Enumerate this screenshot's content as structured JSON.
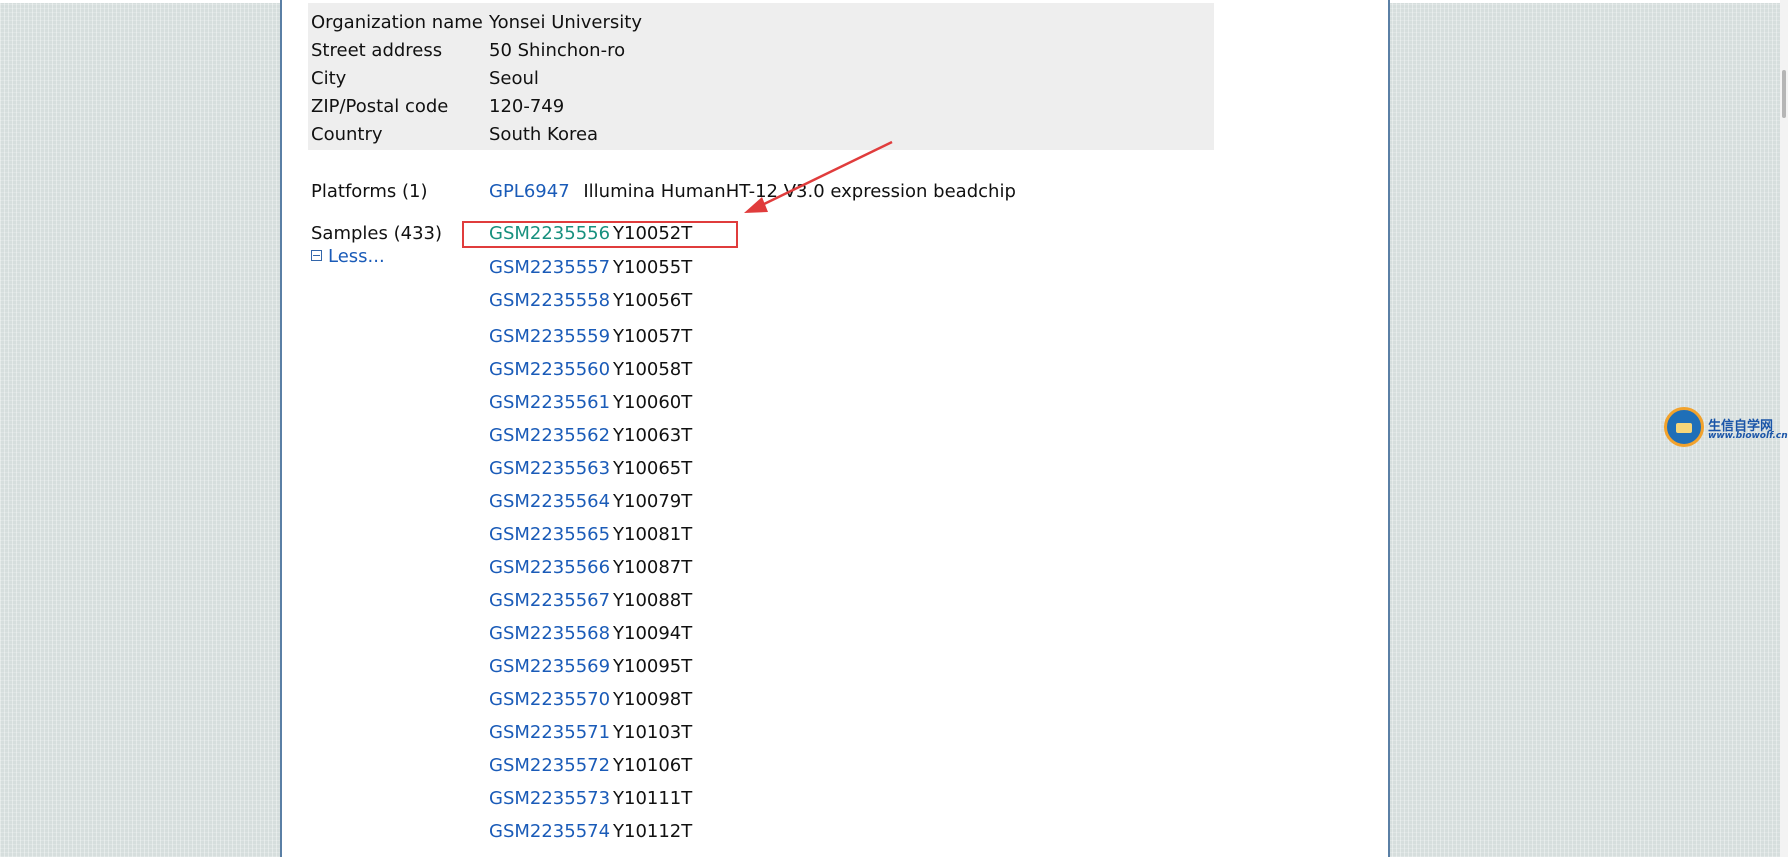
{
  "contact": {
    "rows": [
      {
        "label": "Organization name",
        "value": "Yonsei University"
      },
      {
        "label": "Street address",
        "value": "50 Shinchon-ro"
      },
      {
        "label": "City",
        "value": "Seoul"
      },
      {
        "label": "ZIP/Postal code",
        "value": "120-749"
      },
      {
        "label": "Country",
        "value": "South Korea"
      }
    ]
  },
  "platforms": {
    "label": "Platforms (1)",
    "accession": "GPL6947",
    "title": "Illumina HumanHT-12 V3.0 expression beadchip"
  },
  "samples": {
    "label": "Samples (433)",
    "less_label": "Less...",
    "items": [
      {
        "gsm": "GSM2235556",
        "title": "Y10052T"
      },
      {
        "gsm": "GSM2235557",
        "title": "Y10055T"
      },
      {
        "gsm": "GSM2235558",
        "title": "Y10056T"
      },
      {
        "gsm": "GSM2235559",
        "title": "Y10057T"
      },
      {
        "gsm": "GSM2235560",
        "title": "Y10058T"
      },
      {
        "gsm": "GSM2235561",
        "title": "Y10060T"
      },
      {
        "gsm": "GSM2235562",
        "title": "Y10063T"
      },
      {
        "gsm": "GSM2235563",
        "title": "Y10065T"
      },
      {
        "gsm": "GSM2235564",
        "title": "Y10079T"
      },
      {
        "gsm": "GSM2235565",
        "title": "Y10081T"
      },
      {
        "gsm": "GSM2235566",
        "title": "Y10087T"
      },
      {
        "gsm": "GSM2235567",
        "title": "Y10088T"
      },
      {
        "gsm": "GSM2235568",
        "title": "Y10094T"
      },
      {
        "gsm": "GSM2235569",
        "title": "Y10095T"
      },
      {
        "gsm": "GSM2235570",
        "title": "Y10098T"
      },
      {
        "gsm": "GSM2235571",
        "title": "Y10103T"
      },
      {
        "gsm": "GSM2235572",
        "title": "Y10106T"
      },
      {
        "gsm": "GSM2235573",
        "title": "Y10111T"
      },
      {
        "gsm": "GSM2235574",
        "title": "Y10112T"
      }
    ]
  },
  "watermark": {
    "text": "生信自学网",
    "url": "www.biowolf.cn"
  },
  "colors": {
    "link": "#1a5bb8",
    "visited_link": "#17907e",
    "annotation": "#e03c3c"
  }
}
